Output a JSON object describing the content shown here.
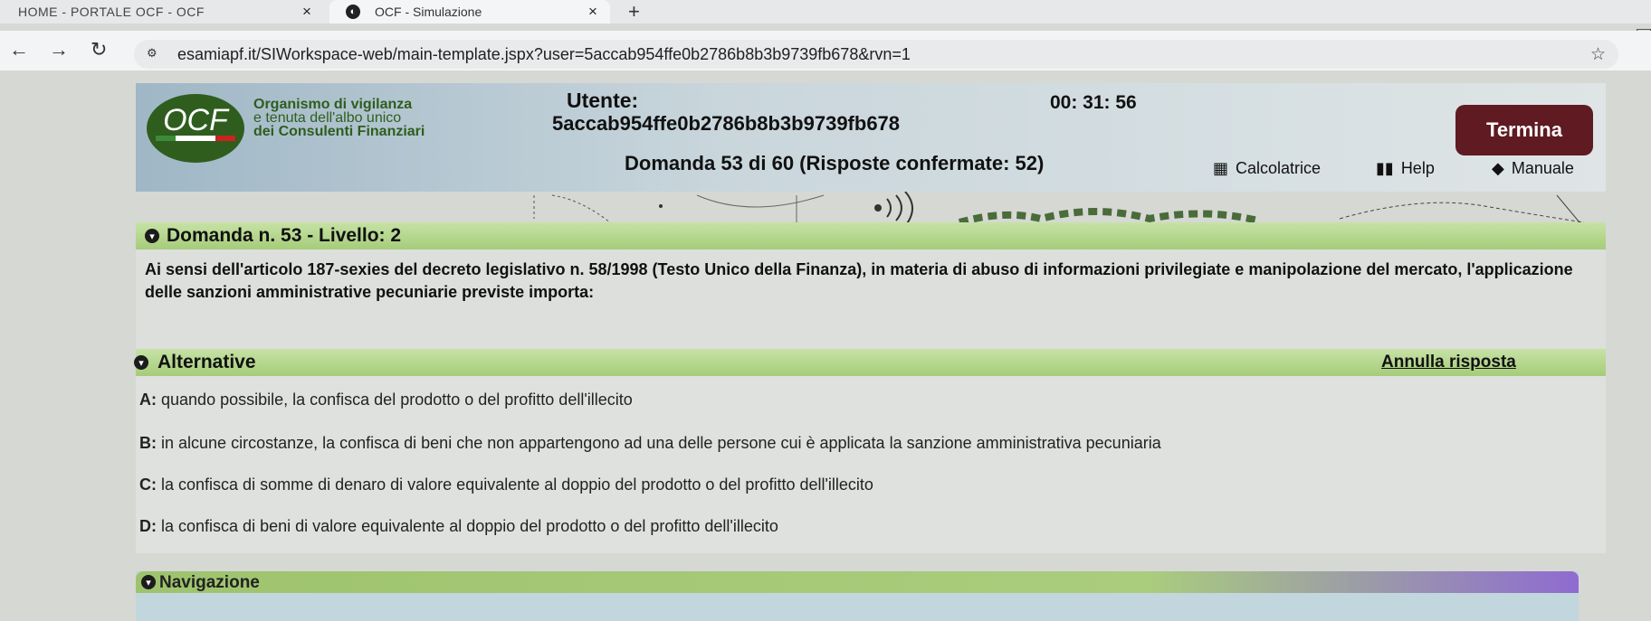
{
  "browser": {
    "tabs": [
      {
        "title": "HOME - PORTALE OCF - OCF",
        "close": "×"
      },
      {
        "title": "OCF - Simulazione",
        "close": "×"
      }
    ],
    "new_tab": "+",
    "url": "esamiapf.it/SIWorkspace-web/main-template.jspx?user=5accab954ffe0b2786b8b3b9739fb678&rvn=1"
  },
  "header": {
    "logo_text": "OCF",
    "org_line1": "Organismo di vigilanza",
    "org_line2": "e tenuta dell'albo unico",
    "org_line3": "dei Consulenti Finanziari",
    "utente_label": "Utente:",
    "utente_value": "5accab954ffe0b2786b8b3b9739fb678",
    "timer": "00: 31: 56",
    "termina_label": "Termina",
    "counter": "Domanda 53 di 60 (Risposte confermate: 52)",
    "tools": {
      "calc": "Calcolatrice",
      "help": "Help",
      "manual": "Manuale"
    }
  },
  "question": {
    "title": "Domanda n. 53 - Livello: 2",
    "text": "Ai sensi dell'articolo 187-sexies del decreto legislativo n. 58/1998 (Testo Unico della Finanza), in materia di abuso di informazioni privilegiate e manipolazione del mercato, l'applicazione delle sanzioni amministrative pecuniarie previste importa:"
  },
  "alternatives": {
    "title": "Alternative",
    "reset_label": "Annulla risposta",
    "options": [
      {
        "key": "A:",
        "text": "quando possibile, la confisca del prodotto o del profitto dell'illecito"
      },
      {
        "key": "B:",
        "text": "in alcune circostanze, la confisca di beni che non appartengono ad una delle persone cui è applicata la sanzione amministrativa pecuniaria"
      },
      {
        "key": "C:",
        "text": "la confisca di somme di denaro di valore equivalente al doppio del prodotto o del profitto dell'illecito"
      },
      {
        "key": "D:",
        "text": "la confisca di beni di valore equivalente al doppio del prodotto o del profitto dell'illecito"
      }
    ]
  },
  "navigation": {
    "title": "Navigazione"
  },
  "colors": {
    "accent_green": "#a6cc7a",
    "termina_bg": "#5f1a22",
    "logo_green": "#2f5d1e"
  }
}
